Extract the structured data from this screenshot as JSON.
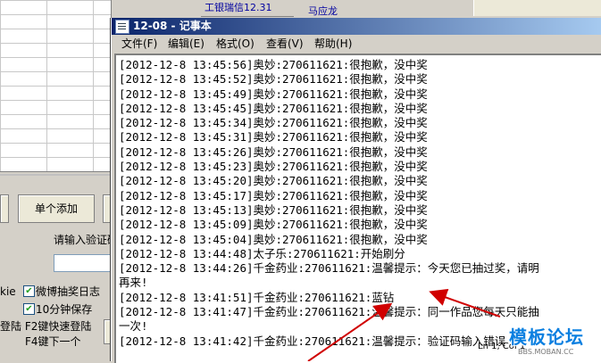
{
  "background_app": {
    "top_field_1": "工银瑞信12.31",
    "top_field_2": "马应龙",
    "add_single_button": "单个添加",
    "captcha_prompt": "请输入验证码",
    "weibo_log_label": "微博抽奖日志",
    "weibo_log_prefix": "kie",
    "save_label": "10分钟保存",
    "f2_label": "登陆 F2键快速登陆",
    "f4_label": "F4键下一个"
  },
  "notepad": {
    "title": "12-08 - 记事本",
    "menu": [
      "文件(F)",
      "编辑(E)",
      "格式(O)",
      "查看(V)",
      "帮助(H)"
    ],
    "lines": [
      "[2012-12-8 13:45:56]奥妙:270611621:很抱歉，没中奖",
      "[2012-12-8 13:45:52]奥妙:270611621:很抱歉，没中奖",
      "[2012-12-8 13:45:49]奥妙:270611621:很抱歉，没中奖",
      "[2012-12-8 13:45:45]奥妙:270611621:很抱歉，没中奖",
      "[2012-12-8 13:45:34]奥妙:270611621:很抱歉，没中奖",
      "[2012-12-8 13:45:31]奥妙:270611621:很抱歉，没中奖",
      "[2012-12-8 13:45:26]奥妙:270611621:很抱歉，没中奖",
      "[2012-12-8 13:45:23]奥妙:270611621:很抱歉，没中奖",
      "[2012-12-8 13:45:20]奥妙:270611621:很抱歉，没中奖",
      "[2012-12-8 13:45:17]奥妙:270611621:很抱歉，没中奖",
      "[2012-12-8 13:45:13]奥妙:270611621:很抱歉，没中奖",
      "[2012-12-8 13:45:09]奥妙:270611621:很抱歉，没中奖",
      "[2012-12-8 13:45:04]奥妙:270611621:很抱歉，没中奖",
      "[2012-12-8 13:44:48]太子乐:270611621:开始刷分",
      "[2012-12-8 13:44:26]千金药业:270611621:温馨提示：今天您已抽过奖，请明",
      "再来!",
      "[2012-12-8 13:41:51]千金药业:270611621:蓝钻",
      "[2012-12-8 13:41:47]千金药业:270611621:温馨提示：同一作品您每天只能抽",
      "一次!",
      "[2012-12-8 13:41:42]千金药业:270611621:温馨提示：验证码输入错误"
    ],
    "status": "Ln 1, Col 1"
  },
  "watermark": {
    "text": "模板论坛",
    "sub": "BBS.MOBAN.CC"
  },
  "colors": {
    "arrow": "#d00000",
    "titlebar_start": "#0a246a",
    "titlebar_end": "#a6caf0"
  }
}
